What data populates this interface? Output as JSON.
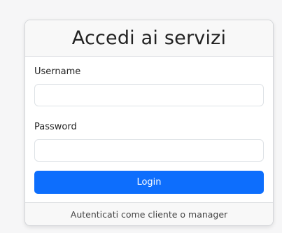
{
  "card": {
    "title": "Accedi ai servizi",
    "username_label": "Username",
    "username_value": "",
    "password_label": "Password",
    "password_value": "",
    "login_label": "Login",
    "footer_text": "Autenticati come cliente o manager"
  },
  "colors": {
    "primary": "#0d6efd"
  }
}
